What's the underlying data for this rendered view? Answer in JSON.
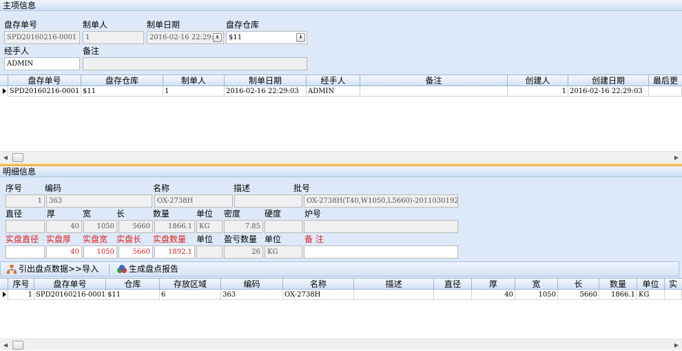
{
  "master": {
    "title": "主项信息",
    "labels": {
      "order_no": "盘存单号",
      "creator": "制单人",
      "date": "制单日期",
      "warehouse": "盘存仓库",
      "handler": "经手人",
      "remark": "备注"
    },
    "values": {
      "order_no": "SPD20160216-0001",
      "creator": "1",
      "date": "2016-02-16 22:29:03",
      "warehouse": "$11",
      "handler": "ADMIN",
      "remark": ""
    },
    "grid": {
      "headers": [
        "盘存单号",
        "盘存仓库",
        "制单人",
        "制单日期",
        "经手人",
        "备注",
        "创建人",
        "创建日期",
        "最后更"
      ],
      "rows": [
        [
          "SPD20160216-0001",
          "$11",
          "1",
          "2016-02-16 22:29:03",
          "ADMIN",
          "",
          "1",
          "2016-02-16 22:29:03",
          ""
        ]
      ]
    }
  },
  "detail": {
    "title": "明细信息",
    "labels": {
      "seq": "序号",
      "code": "编码",
      "name": "名称",
      "desc": "描述",
      "batch": "批号",
      "diameter": "直径",
      "thickness": "厚",
      "width": "宽",
      "length": "长",
      "qty": "数量",
      "unit": "单位",
      "density": "密度",
      "hardness": "硬度",
      "furnace": "炉号",
      "act_diameter": "实盘直径",
      "act_thickness": "实盘厚",
      "act_width": "实盘宽",
      "act_length": "实盘长",
      "act_qty": "实盘数量",
      "act_unit": "单位",
      "diff_qty": "盈亏数量",
      "diff_unit": "单位",
      "act_remark": "备 注"
    },
    "values": {
      "seq": "1",
      "code": "363",
      "name": "OX-2738H",
      "desc": "",
      "batch": "OX-2738H(T40,W1050,L5660)-2011030192",
      "diameter": "",
      "thickness": "40",
      "width": "1050",
      "length": "5660",
      "qty": "1866.1",
      "unit": "KG",
      "density": "7.85",
      "hardness": "",
      "furnace": "",
      "act_diameter": "",
      "act_thickness": "40",
      "act_width": "1050",
      "act_length": "5660",
      "act_qty": "1892.1",
      "act_unit": "",
      "diff_qty": "26",
      "diff_unit": "KG",
      "act_remark": ""
    },
    "toolbar": {
      "import_label": "引出盘点数据>>导入",
      "report_label": "生成盘点报告"
    },
    "grid": {
      "headers": [
        "序号",
        "盘存单号",
        "仓库",
        "存放区域",
        "编码",
        "名称",
        "描述",
        "直径",
        "厚",
        "宽",
        "长",
        "数量",
        "单位",
        "实"
      ],
      "rows": [
        [
          "1",
          "SPD20160216-0001",
          "$11",
          "6",
          "363",
          "OX-2738H",
          "",
          "",
          "40",
          "1050",
          "5660",
          "1866.1",
          "KG",
          ""
        ]
      ]
    }
  },
  "icons": {
    "dropdown": "dropdown-arrow-icon",
    "import": "org-chart-icon",
    "report": "report-icon",
    "row_pointer": "row-pointer-icon"
  },
  "colors": {
    "panel_bg": "#dde9f8",
    "red_label": "#e02020",
    "splitter": "#e8a83c"
  }
}
